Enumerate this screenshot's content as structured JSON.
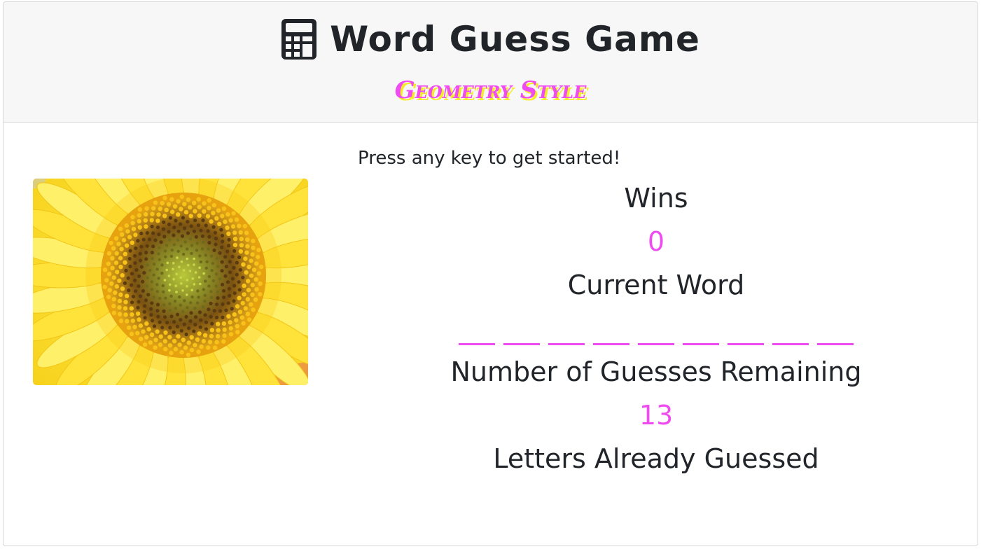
{
  "header": {
    "icon": "calculator-icon",
    "title": "Word Guess Game",
    "subtitle": "Geometry Style",
    "subtitle_color": "#ee4cf0",
    "subtitle_shadow_color": "#f4ec2a"
  },
  "image": {
    "subject": "sunflower-image"
  },
  "main": {
    "prompt": "Press any key to get started!",
    "wins_label": "Wins",
    "wins_value": "0",
    "current_word_label": "Current Word",
    "current_word_blank_count": 9,
    "guesses_label": "Number of Guesses Remaining",
    "guesses_value": "13",
    "letters_label": "Letters Already Guessed",
    "letters_value": "",
    "accent_color": "#ee4cf0"
  }
}
